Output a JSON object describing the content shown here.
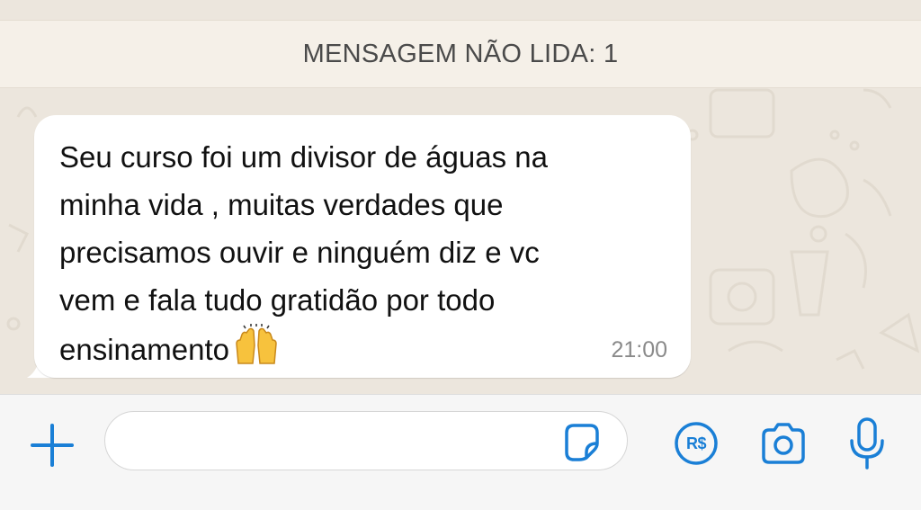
{
  "banner": {
    "label": "MENSAGEM NÃO LIDA: 1"
  },
  "message": {
    "text": "Seu curso foi um divisor de águas na\nminha vida , muitas verdades que\nprecisamos ouvir e ninguém diz e vc\nvem e fala tudo gratidão por todo\nensinamento",
    "emoji": "raising-hands-emoji",
    "time": "21:00"
  },
  "input_bar": {
    "add_icon": "plus-icon",
    "message_input": {
      "value": "",
      "placeholder": ""
    },
    "sticker_icon": "sticker-icon",
    "payment_icon": "pix-payment-icon",
    "payment_label": "R$",
    "camera_icon": "camera-icon",
    "mic_icon": "microphone-icon"
  },
  "colors": {
    "accent": "#1a7fd6",
    "chat_background": "#ece6dd",
    "bubble": "#ffffff"
  }
}
